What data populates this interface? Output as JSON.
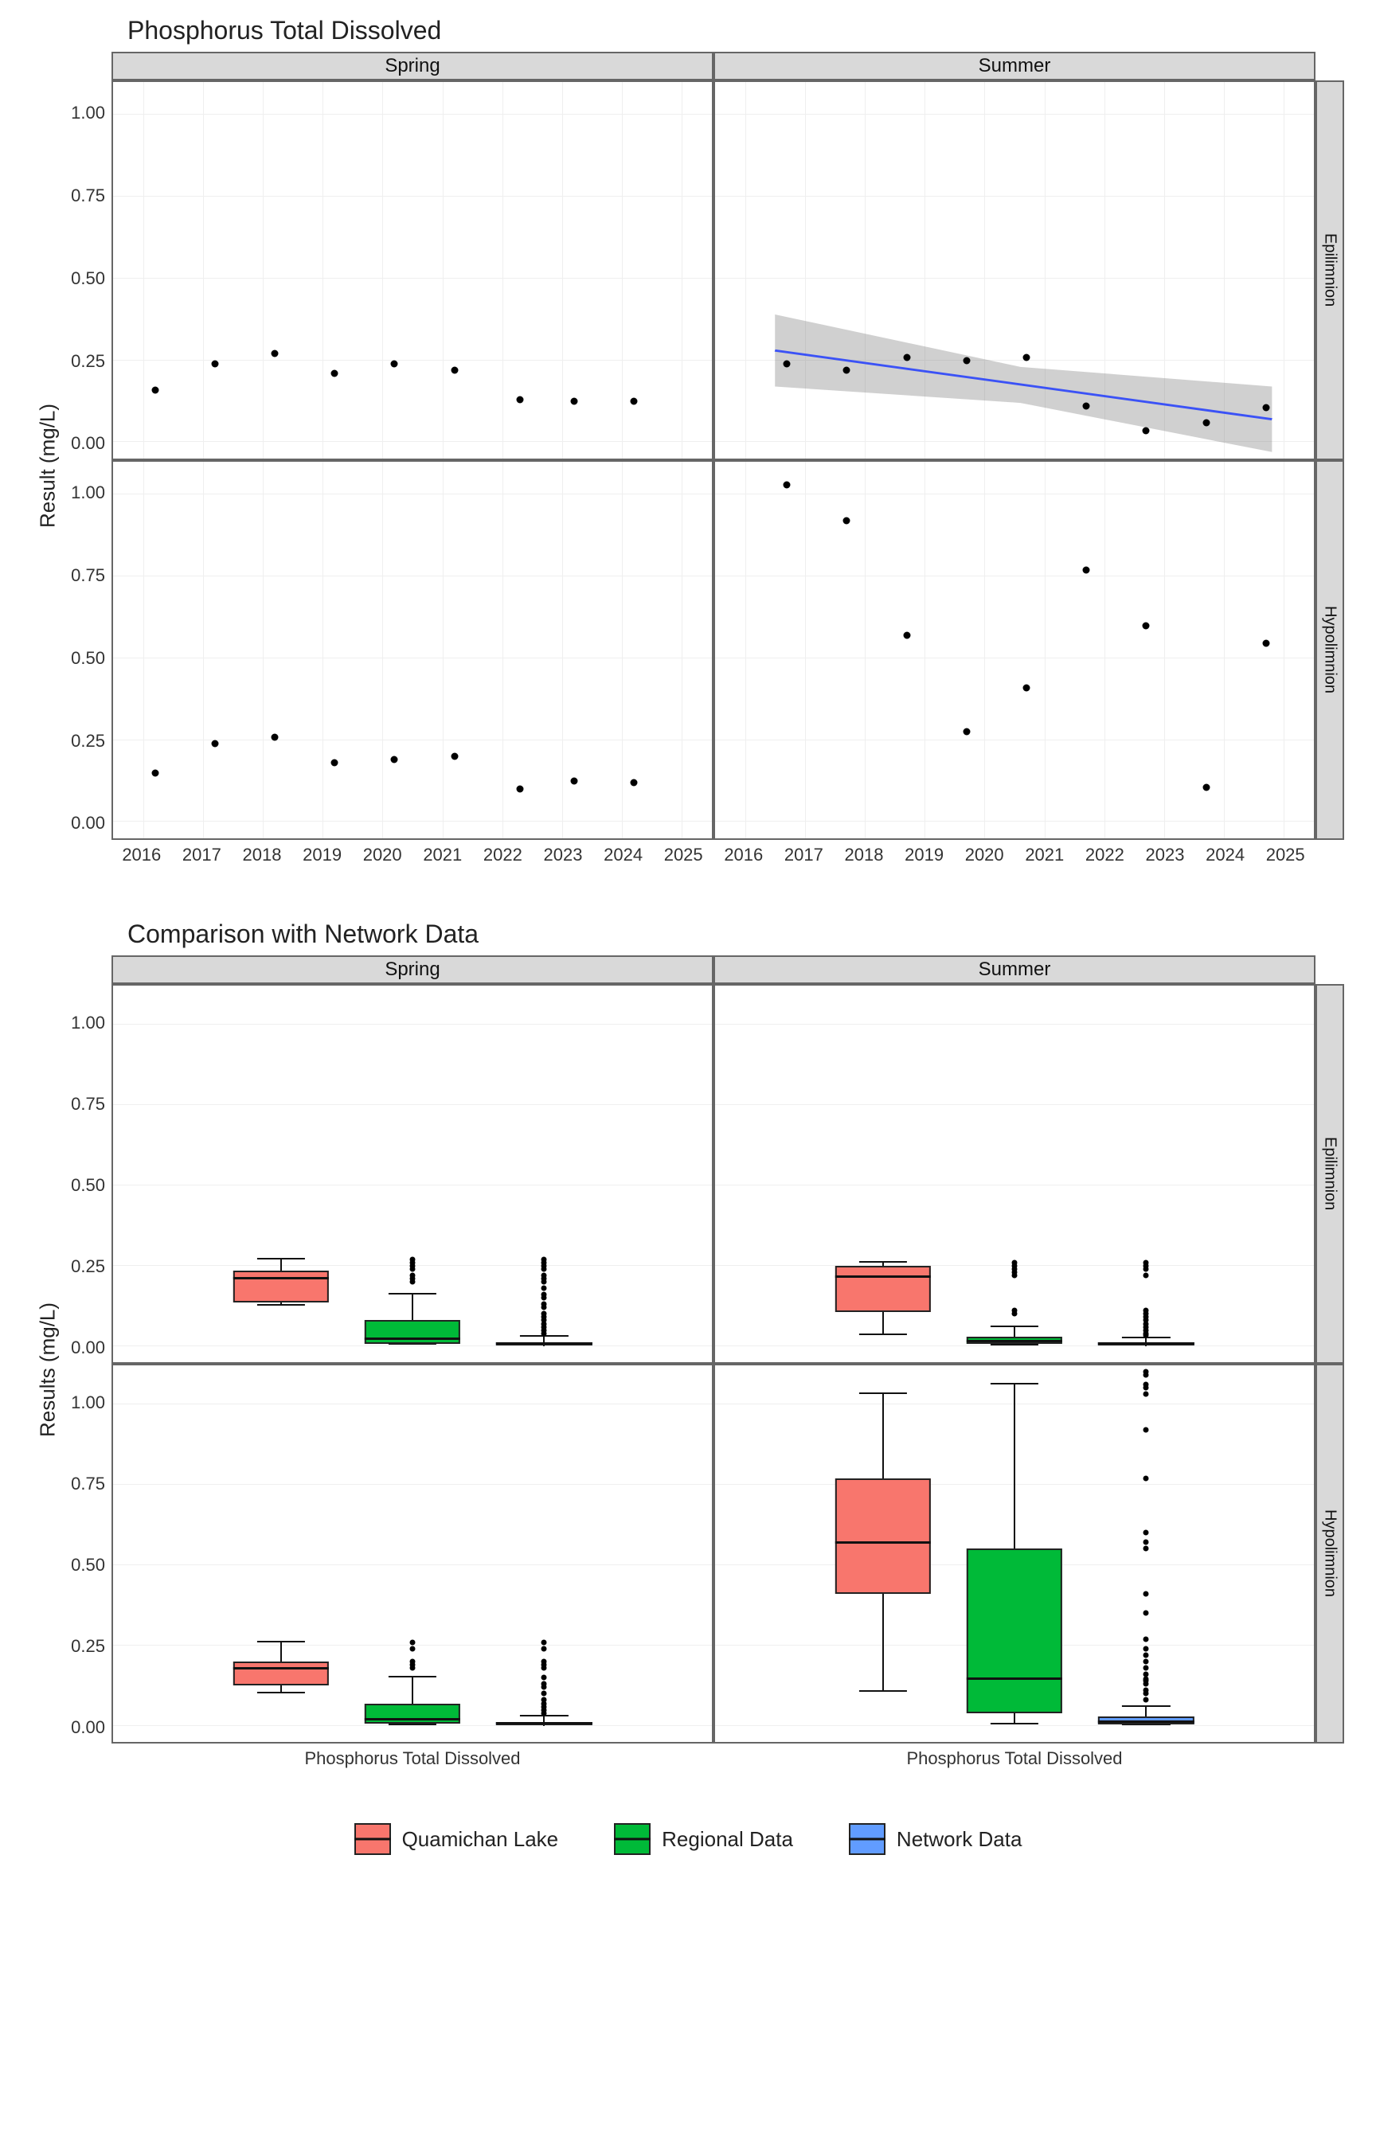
{
  "chart_data": [
    {
      "id": "scatter_facets",
      "title": "Phosphorus Total Dissolved",
      "type": "scatter",
      "facet_cols": [
        "Spring",
        "Summer"
      ],
      "facet_rows": [
        "Epilimnion",
        "Hypolimnion"
      ],
      "xlabel": "",
      "ylabel": "Result (mg/L)",
      "x_ticks": [
        2016,
        2017,
        2018,
        2019,
        2020,
        2021,
        2022,
        2023,
        2024,
        2025
      ],
      "y_ticks": [
        0.0,
        0.25,
        0.5,
        0.75,
        1.0
      ],
      "xlim": [
        2015.5,
        2025.5
      ],
      "ylim": [
        -0.05,
        1.1
      ],
      "panels": {
        "Spring|Epilimnion": {
          "points": [
            {
              "x": 2016.2,
              "y": 0.16
            },
            {
              "x": 2017.2,
              "y": 0.24
            },
            {
              "x": 2018.2,
              "y": 0.27
            },
            {
              "x": 2019.2,
              "y": 0.21
            },
            {
              "x": 2020.2,
              "y": 0.24
            },
            {
              "x": 2021.2,
              "y": 0.22
            },
            {
              "x": 2022.3,
              "y": 0.13
            },
            {
              "x": 2023.2,
              "y": 0.125
            },
            {
              "x": 2024.2,
              "y": 0.125
            }
          ]
        },
        "Summer|Epilimnion": {
          "points": [
            {
              "x": 2016.7,
              "y": 0.24
            },
            {
              "x": 2017.7,
              "y": 0.22
            },
            {
              "x": 2018.7,
              "y": 0.26
            },
            {
              "x": 2019.7,
              "y": 0.25
            },
            {
              "x": 2020.7,
              "y": 0.26
            },
            {
              "x": 2021.7,
              "y": 0.11
            },
            {
              "x": 2022.7,
              "y": 0.035
            },
            {
              "x": 2023.7,
              "y": 0.06
            },
            {
              "x": 2024.7,
              "y": 0.105
            }
          ],
          "trend": {
            "x0": 2016.5,
            "y0": 0.28,
            "x1": 2024.8,
            "y1": 0.07
          },
          "ribbon": [
            {
              "x": 2016.5,
              "lo": 0.17,
              "hi": 0.39
            },
            {
              "x": 2020.6,
              "lo": 0.12,
              "hi": 0.23
            },
            {
              "x": 2024.8,
              "lo": -0.03,
              "hi": 0.17
            }
          ]
        },
        "Spring|Hypolimnion": {
          "points": [
            {
              "x": 2016.2,
              "y": 0.15
            },
            {
              "x": 2017.2,
              "y": 0.24
            },
            {
              "x": 2018.2,
              "y": 0.26
            },
            {
              "x": 2019.2,
              "y": 0.18
            },
            {
              "x": 2020.2,
              "y": 0.19
            },
            {
              "x": 2021.2,
              "y": 0.2
            },
            {
              "x": 2022.3,
              "y": 0.1
            },
            {
              "x": 2023.2,
              "y": 0.125
            },
            {
              "x": 2024.2,
              "y": 0.12
            }
          ]
        },
        "Summer|Hypolimnion": {
          "points": [
            {
              "x": 2016.7,
              "y": 1.03
            },
            {
              "x": 2017.7,
              "y": 0.92
            },
            {
              "x": 2018.7,
              "y": 0.57
            },
            {
              "x": 2019.7,
              "y": 0.275
            },
            {
              "x": 2020.7,
              "y": 0.41
            },
            {
              "x": 2021.7,
              "y": 0.77
            },
            {
              "x": 2022.7,
              "y": 0.6
            },
            {
              "x": 2023.7,
              "y": 0.105
            },
            {
              "x": 2024.7,
              "y": 0.545
            }
          ]
        }
      }
    },
    {
      "id": "box_facets",
      "title": "Comparison with Network Data",
      "type": "boxplot",
      "facet_cols": [
        "Spring",
        "Summer"
      ],
      "facet_rows": [
        "Epilimnion",
        "Hypolimnion"
      ],
      "xlabel_per_panel": "Phosphorus Total Dissolved",
      "ylabel": "Results (mg/L)",
      "y_ticks": [
        0.0,
        0.25,
        0.5,
        0.75,
        1.0
      ],
      "ylim": [
        -0.05,
        1.12
      ],
      "series": [
        "Quamichan Lake",
        "Regional Data",
        "Network Data"
      ],
      "colors": {
        "Quamichan Lake": "#f8766d",
        "Regional Data": "#00ba38",
        "Network Data": "#619cff"
      },
      "panels": {
        "Spring|Epilimnion": {
          "boxes": [
            {
              "series": "Quamichan Lake",
              "min": 0.125,
              "q1": 0.135,
              "med": 0.215,
              "q3": 0.235,
              "max": 0.27,
              "outliers": []
            },
            {
              "series": "Regional Data",
              "min": 0.005,
              "q1": 0.008,
              "med": 0.02,
              "q3": 0.08,
              "max": 0.16,
              "outliers": [
                0.2,
                0.21,
                0.22,
                0.24,
                0.25,
                0.26,
                0.27
              ]
            },
            {
              "series": "Network Data",
              "min": 0.001,
              "q1": 0.003,
              "med": 0.006,
              "q3": 0.012,
              "max": 0.03,
              "outliers": [
                0.04,
                0.05,
                0.06,
                0.07,
                0.08,
                0.09,
                0.1,
                0.12,
                0.13,
                0.15,
                0.16,
                0.18,
                0.2,
                0.21,
                0.22,
                0.24,
                0.25,
                0.26,
                0.27
              ]
            }
          ]
        },
        "Summer|Epilimnion": {
          "boxes": [
            {
              "series": "Quamichan Lake",
              "min": 0.035,
              "q1": 0.105,
              "med": 0.22,
              "q3": 0.25,
              "max": 0.26,
              "outliers": []
            },
            {
              "series": "Regional Data",
              "min": 0.003,
              "q1": 0.006,
              "med": 0.012,
              "q3": 0.03,
              "max": 0.06,
              "outliers": [
                0.1,
                0.11,
                0.22,
                0.23,
                0.24,
                0.25,
                0.26
              ]
            },
            {
              "series": "Network Data",
              "min": 0.001,
              "q1": 0.003,
              "med": 0.006,
              "q3": 0.012,
              "max": 0.025,
              "outliers": [
                0.035,
                0.04,
                0.05,
                0.06,
                0.07,
                0.08,
                0.09,
                0.1,
                0.11,
                0.22,
                0.24,
                0.25,
                0.26
              ]
            }
          ]
        },
        "Spring|Hypolimnion": {
          "boxes": [
            {
              "series": "Quamichan Lake",
              "min": 0.1,
              "q1": 0.125,
              "med": 0.18,
              "q3": 0.2,
              "max": 0.26,
              "outliers": []
            },
            {
              "series": "Regional Data",
              "min": 0.003,
              "q1": 0.007,
              "med": 0.018,
              "q3": 0.07,
              "max": 0.15,
              "outliers": [
                0.18,
                0.19,
                0.2,
                0.24,
                0.26
              ]
            },
            {
              "series": "Network Data",
              "min": 0.001,
              "q1": 0.003,
              "med": 0.006,
              "q3": 0.012,
              "max": 0.03,
              "outliers": [
                0.04,
                0.05,
                0.06,
                0.07,
                0.08,
                0.1,
                0.12,
                0.13,
                0.15,
                0.18,
                0.19,
                0.2,
                0.24,
                0.26
              ]
            }
          ]
        },
        "Summer|Hypolimnion": {
          "boxes": [
            {
              "series": "Quamichan Lake",
              "min": 0.105,
              "q1": 0.41,
              "med": 0.57,
              "q3": 0.77,
              "max": 1.03,
              "outliers": []
            },
            {
              "series": "Regional Data",
              "min": 0.005,
              "q1": 0.04,
              "med": 0.145,
              "q3": 0.55,
              "max": 1.06,
              "outliers": []
            },
            {
              "series": "Network Data",
              "min": 0.001,
              "q1": 0.004,
              "med": 0.009,
              "q3": 0.028,
              "max": 0.06,
              "outliers": [
                0.08,
                0.1,
                0.11,
                0.13,
                0.14,
                0.145,
                0.16,
                0.18,
                0.2,
                0.22,
                0.24,
                0.27,
                0.35,
                0.41,
                0.55,
                0.57,
                0.6,
                0.77,
                0.92,
                1.03,
                1.05,
                1.06,
                1.09,
                1.1
              ]
            }
          ]
        }
      }
    }
  ],
  "legend": {
    "items": [
      {
        "label": "Quamichan Lake",
        "color": "red"
      },
      {
        "label": "Regional Data",
        "color": "green"
      },
      {
        "label": "Network Data",
        "color": "blue"
      }
    ]
  }
}
